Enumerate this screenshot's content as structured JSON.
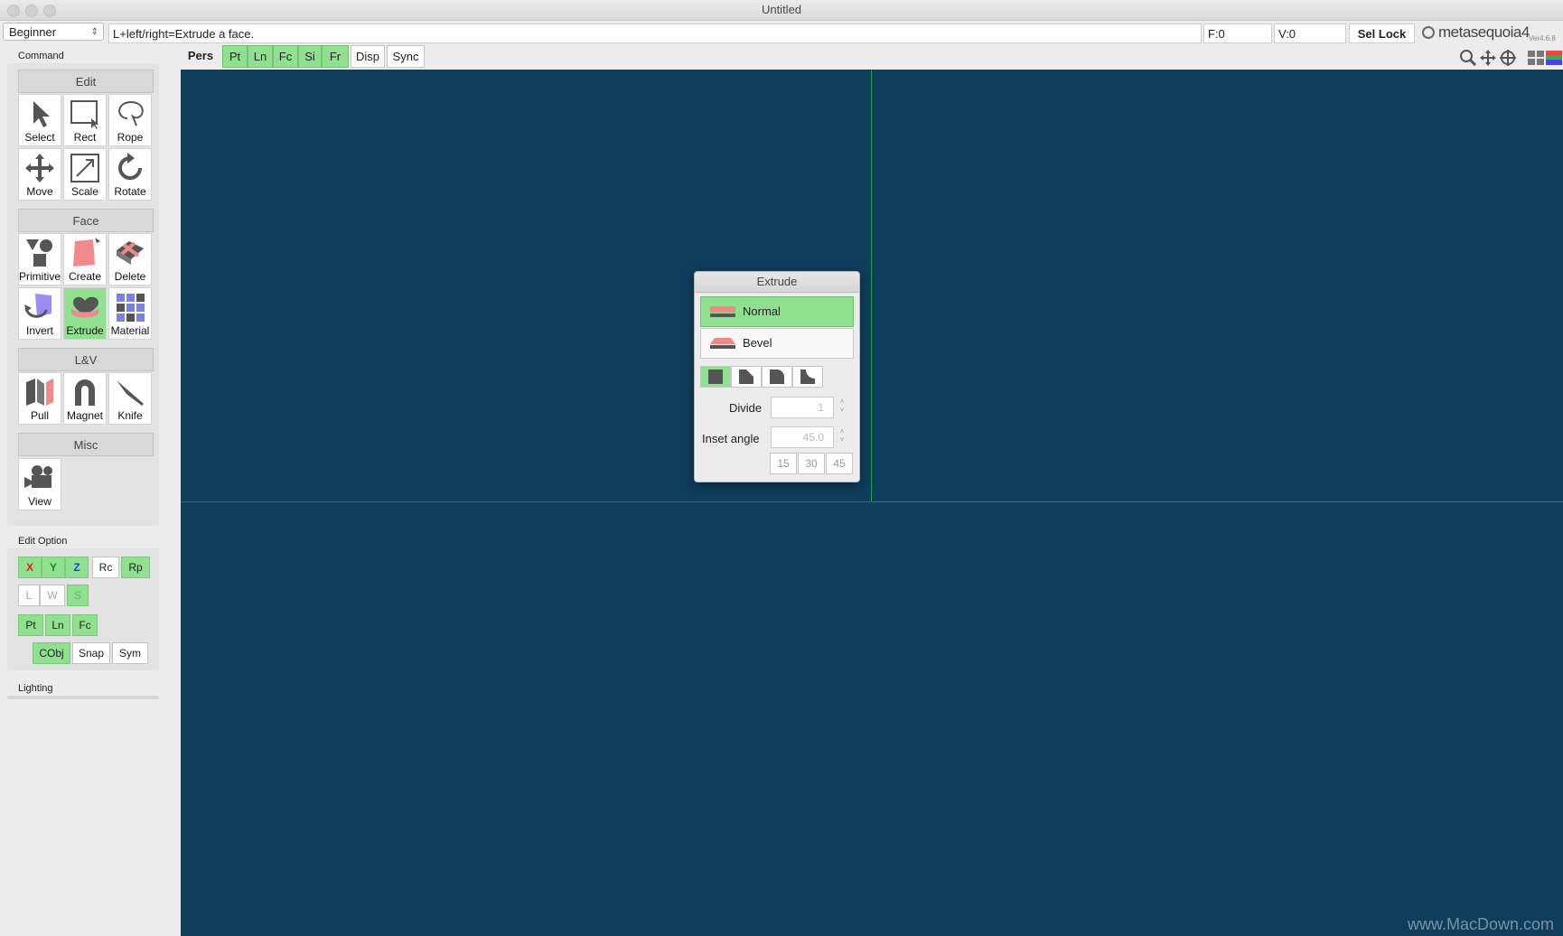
{
  "window": {
    "title": "Untitled"
  },
  "topbar": {
    "mode": "Beginner",
    "hint": "L+left/right=Extrude a face.",
    "faces": "F:0",
    "vertices": "V:0",
    "sel_lock": "Sel Lock",
    "logo_text": "metasequoia4",
    "version": "Ver4.6.8"
  },
  "sidebar": {
    "command_label": "Command",
    "groups": [
      {
        "title": "Edit",
        "tools": [
          "Select",
          "Rect",
          "Rope",
          "Move",
          "Scale",
          "Rotate"
        ]
      },
      {
        "title": "Face",
        "tools": [
          "Primitive",
          "Create",
          "Delete",
          "Invert",
          "Extrude",
          "Material"
        ]
      },
      {
        "title": "L&V",
        "tools": [
          "Pull",
          "Magnet",
          "Knife"
        ]
      },
      {
        "title": "Misc",
        "tools": [
          "View"
        ]
      }
    ],
    "edit_option_label": "Edit Option",
    "axis_buttons": [
      "X",
      "Y",
      "Z"
    ],
    "rc": "Rc",
    "rp": "Rp",
    "space_buttons": [
      "L",
      "W",
      "S"
    ],
    "select_buttons": [
      "Pt",
      "Ln",
      "Fc"
    ],
    "obj_buttons": [
      "CObj",
      "Snap",
      "Sym"
    ],
    "lighting_label": "Lighting"
  },
  "viewtabs": {
    "view_name": "Pers",
    "items": [
      "Pt",
      "Ln",
      "Fc",
      "Si",
      "Fr",
      "Disp",
      "Sync"
    ]
  },
  "extrude_dialog": {
    "title": "Extrude",
    "options": [
      "Normal",
      "Bevel"
    ],
    "divide_label": "Divide",
    "divide_value": "1",
    "inset_label": "Inset angle",
    "inset_value": "45.0",
    "angle_presets": [
      "15",
      "30",
      "45"
    ]
  },
  "watermark": "www.MacDown.com",
  "colors": {
    "viewport": "#0f3d5c",
    "active_green": "#8fe08f",
    "axis_green": "#1aa54a",
    "axis_blue": "#2a58e0"
  }
}
